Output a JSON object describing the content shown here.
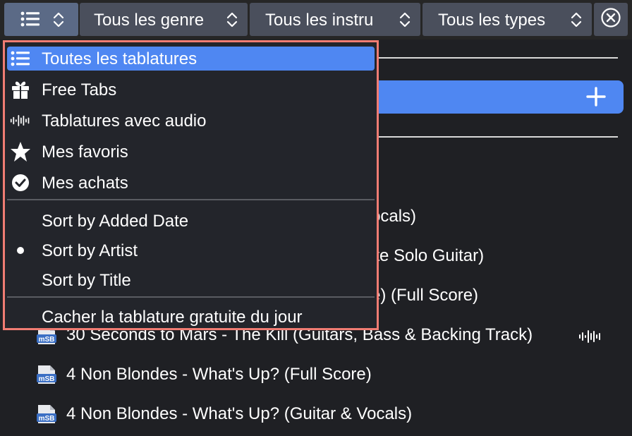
{
  "toolbar": {
    "genres": "Tous les genre",
    "instruments": "Tous les instru",
    "types": "Tous les types"
  },
  "dropdown": {
    "items": [
      {
        "label": "Toutes les tablatures",
        "icon": "list-icon",
        "selected": true
      },
      {
        "label": "Free Tabs",
        "icon": "gift-icon",
        "selected": false
      },
      {
        "label": "Tablatures avec audio",
        "icon": "audio-wave-icon",
        "selected": false
      },
      {
        "label": "Mes favoris",
        "icon": "star-icon",
        "selected": false
      },
      {
        "label": "Mes achats",
        "icon": "check-circle-icon",
        "selected": false
      }
    ],
    "sort": [
      {
        "label": "Sort by Added Date",
        "checked": false
      },
      {
        "label": "Sort by Artist",
        "checked": true
      },
      {
        "label": "Sort by Title",
        "checked": false
      }
    ],
    "hide_free": "Cacher la tablature gratuite du jour"
  },
  "list": {
    "highlight_paren": ")",
    "partial_rows": [
      {
        "title": "ocals)"
      },
      {
        "title": "ite Solo Guitar)"
      },
      {
        "title": "e) (Full Score)"
      }
    ],
    "rows": [
      {
        "icon": "msb-file-icon",
        "file_label": "mSB",
        "title": "30 Seconds to Mars - The Kill (Guitars, Bass & Backing Track)",
        "has_audio": true
      },
      {
        "icon": "msb-file-icon",
        "file_label": "mSB",
        "title": "4 Non Blondes - What's Up? (Full Score)",
        "has_audio": false
      },
      {
        "icon": "msb-file-icon",
        "file_label": "mSB",
        "title": "4 Non Blondes - What's Up? (Guitar & Vocals)",
        "has_audio": false
      }
    ]
  },
  "colors": {
    "accent": "#4f87f2",
    "dropdown_border": "#f07c73",
    "toolbar_button": "#4a4f5c"
  }
}
